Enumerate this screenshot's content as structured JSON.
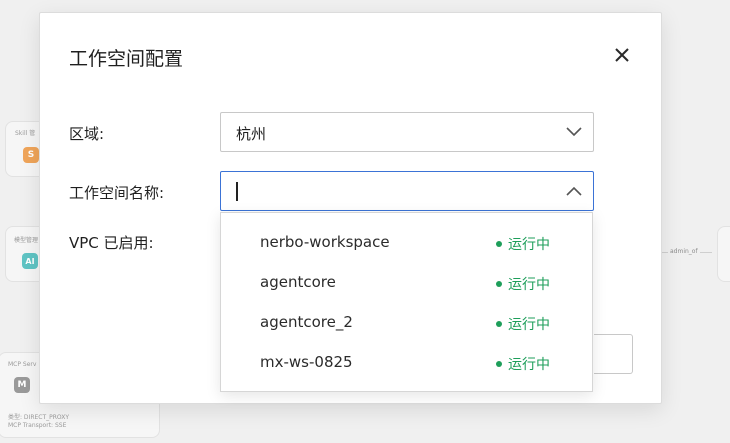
{
  "background": {
    "skill_label": "Skill 管",
    "skill_badge": "S",
    "model_label": "模型管理",
    "model_badge": "AI",
    "mcp_label": "MCP Serv",
    "mcp_badge": "M",
    "mcp_line1": "类型: DIRECT_PROXY",
    "mcp_line2": "MCP Transport: SSE",
    "edge_label": "admin_of",
    "colors": {
      "skill_badge": "#f0a55a",
      "model_badge": "#5fc4c4",
      "mcp_badge": "#9a9a9a"
    }
  },
  "modal": {
    "title": "工作空间配置",
    "close_icon": "close-icon",
    "region_label": "区域:",
    "region_value": "杭州",
    "workspace_label": "工作空间名称:",
    "workspace_value": "",
    "vpc_label": "VPC 已启用:"
  },
  "dropdown": {
    "options": [
      {
        "name": "nerbo-workspace",
        "status": "运行中"
      },
      {
        "name": "agentcore",
        "status": "运行中"
      },
      {
        "name": "agentcore_2",
        "status": "运行中"
      },
      {
        "name": "mx-ws-0825",
        "status": "运行中"
      }
    ],
    "status_color": "#1e9e5a",
    "accent_color": "#3b73d6"
  }
}
